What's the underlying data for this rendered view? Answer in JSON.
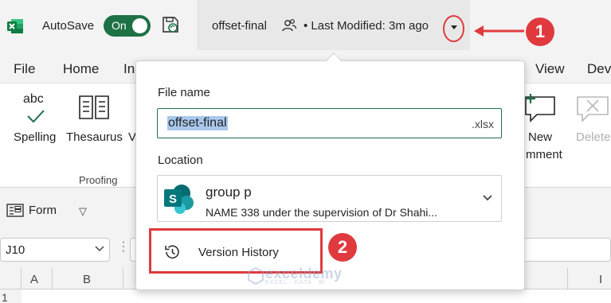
{
  "titlebar": {
    "autosave_label": "AutoSave",
    "toggle_state": "On",
    "file_title": "offset-final",
    "modified": "• Last Modified: 3m ago"
  },
  "menu": {
    "items": [
      "File",
      "Home",
      "In",
      "View",
      "Dev"
    ]
  },
  "ribbon": {
    "spelling_icon_text": "abc",
    "spelling_label": "Spelling",
    "thesaurus_label": "Thesaurus",
    "partial_label": "V",
    "group_label": "Proofing",
    "new_comment_line1": "New",
    "new_comment_line2": "mment",
    "delete_label": "Delete"
  },
  "formbar": {
    "form_label": "Form",
    "dropdown_glyph": "▽"
  },
  "namebox": {
    "value": "J10",
    "dots": "⋮"
  },
  "grid": {
    "columns": [
      "A",
      "B",
      "I"
    ],
    "rows": [
      "1"
    ]
  },
  "popover": {
    "filename_label": "File name",
    "filename_value": "offset-final",
    "filename_ext": ".xlsx",
    "location_label": "Location",
    "location_name": "group p",
    "location_desc": "NAME 338 under the supervision of Dr Shahi...",
    "version_history_label": "Version History"
  },
  "annotations": {
    "badge1": "1",
    "badge2": "2",
    "accent_color": "#e03a3e"
  },
  "watermark": {
    "name": "exceldemy",
    "tagline": "EXCEL · DATA · BI"
  },
  "colors": {
    "excel_green": "#1e7145",
    "selection": "#a9c8ec"
  }
}
